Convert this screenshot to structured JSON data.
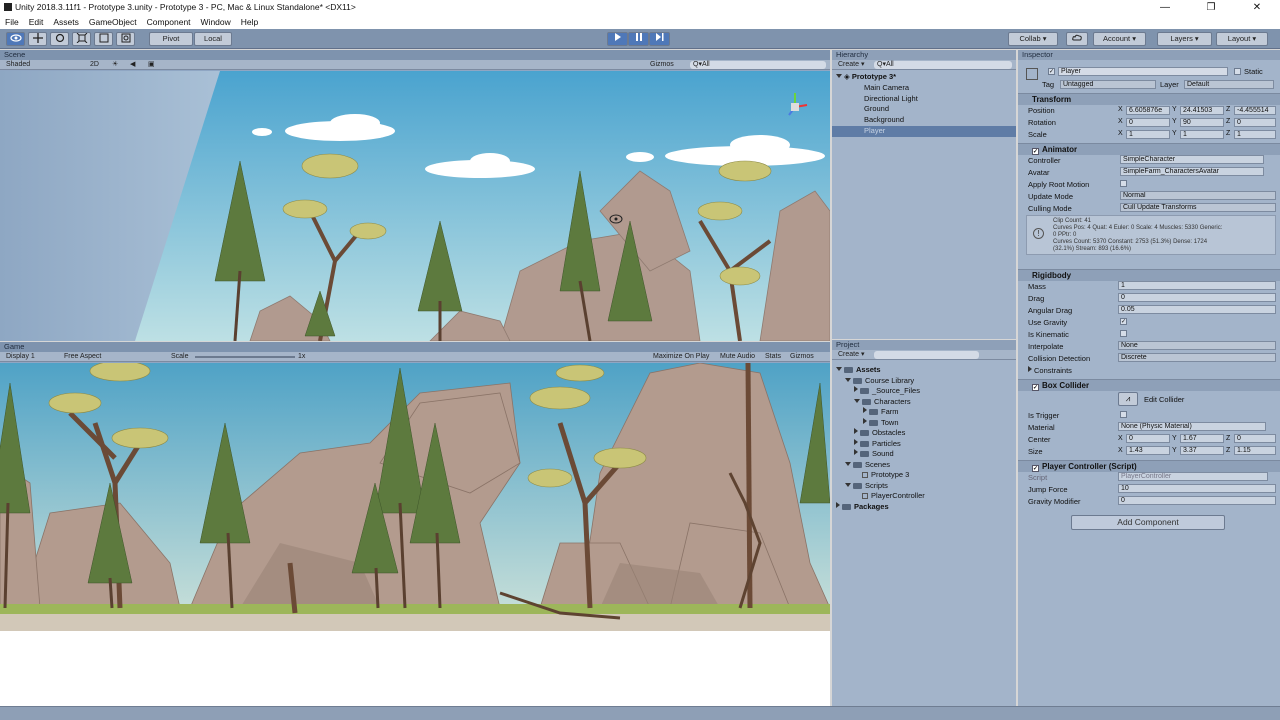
{
  "window": {
    "title": "Unity 2018.3.11f1 - Prototype 3.unity - Prototype 3 - PC, Mac & Linux Standalone* <DX11>",
    "controls": [
      "—",
      "❐",
      "✕"
    ]
  },
  "menu": [
    "File",
    "Edit",
    "Assets",
    "GameObject",
    "Component",
    "Window",
    "Help"
  ],
  "toolbar": {
    "tools": [
      "hand-tool-icon",
      "move-tool-icon",
      "rotate-tool-icon",
      "scale-tool-icon",
      "rect-tool-icon",
      "transform-tool-icon"
    ],
    "pivot": "Pivot",
    "local": "Local",
    "collab": "Collab ▾",
    "account": "Account",
    "layers": "Layers",
    "layout": "Layout",
    "accent": "#4f78b8"
  },
  "scene": {
    "tab": "Scene",
    "shading": "Shaded",
    "mode2d": "2D",
    "gizmos": "Gizmos",
    "search": "Q▾All"
  },
  "game": {
    "tab": "Game",
    "display": "Display 1",
    "aspect": "Free Aspect",
    "scale_label": "Scale",
    "scale_value": "1x",
    "maximize": "Maximize On Play",
    "mute": "Mute Audio",
    "stats": "Stats",
    "gizmos": "Gizmos"
  },
  "hierarchy": {
    "tab": "Hierarchy",
    "create": "Create ▾",
    "search": "Q▾All",
    "root": "Prototype 3*",
    "items": [
      "Main Camera",
      "Directional Light",
      "Ground",
      "Background",
      "Player"
    ]
  },
  "project": {
    "tab": "Project",
    "create": "Create ▾",
    "tree": [
      {
        "label": "Assets",
        "depth": 0,
        "bold": true
      },
      {
        "label": "Course Library",
        "depth": 1
      },
      {
        "label": "_Source_Files",
        "depth": 2
      },
      {
        "label": "Characters",
        "depth": 2
      },
      {
        "label": "Farm",
        "depth": 3
      },
      {
        "label": "Town",
        "depth": 3
      },
      {
        "label": "Obstacles",
        "depth": 2
      },
      {
        "label": "Particles",
        "depth": 2
      },
      {
        "label": "Sound",
        "depth": 2
      },
      {
        "label": "Scenes",
        "depth": 1
      },
      {
        "label": "Prototype 3",
        "depth": 2
      },
      {
        "label": "Scripts",
        "depth": 1
      },
      {
        "label": "PlayerController",
        "depth": 2
      },
      {
        "label": "Packages",
        "depth": 0,
        "bold": true
      }
    ]
  },
  "inspector": {
    "tab": "Inspector",
    "object_name": "Player",
    "static": "Static",
    "tag_label": "Tag",
    "tag": "Untagged",
    "layer_label": "Layer",
    "layer": "Default",
    "transform": {
      "title": "Transform",
      "position_label": "Position",
      "position": [
        "6.605876e",
        "24.41503",
        "-4.455514"
      ],
      "rotation_label": "Rotation",
      "rotation": [
        "0",
        "90",
        "0"
      ],
      "scale_label": "Scale",
      "scale": [
        "1",
        "1",
        "1"
      ]
    },
    "animator": {
      "title": "Animator",
      "controller_label": "Controller",
      "controller": "SimpleCharacter",
      "avatar_label": "Avatar",
      "avatar": "SimpleFarm_CharactersAvatar",
      "root_motion_label": "Apply Root Motion",
      "update_mode_label": "Update Mode",
      "update_mode": "Normal",
      "culling_label": "Culling Mode",
      "culling": "Cull Update Transforms",
      "info": [
        "Clip Count: 41",
        "Curves Pos: 4 Quat: 4 Euler: 0 Scale: 4 Muscles: 5330 Generic:",
        "0 PPtr: 0",
        "Curves Count: 5370 Constant: 2753 (51.3%) Dense: 1724",
        "(32.1%) Stream: 893 (16.6%)"
      ]
    },
    "rigidbody": {
      "title": "Rigidbody",
      "mass_label": "Mass",
      "mass": "1",
      "drag_label": "Drag",
      "drag": "0",
      "angular_label": "Angular Drag",
      "angular": "0.05",
      "gravity_label": "Use Gravity",
      "kinematic_label": "Is Kinematic",
      "interp_label": "Interpolate",
      "interp": "None",
      "collision_label": "Collision Detection",
      "collision": "Discrete",
      "constraints_label": "Constraints"
    },
    "box_collider": {
      "title": "Box Collider",
      "edit": "Edit Collider",
      "trigger_label": "Is Trigger",
      "material_label": "Material",
      "material": "None (Physic Material)",
      "center_label": "Center",
      "center": [
        "0",
        "1.67",
        "0"
      ],
      "size_label": "Size",
      "size": [
        "1.43",
        "3.37",
        "1.15"
      ]
    },
    "player_controller": {
      "title": "Player Controller (Script)",
      "script_label": "Script",
      "script": "PlayerController",
      "jump_label": "Jump Force",
      "jump": "10",
      "gravity_mod_label": "Gravity Modifier",
      "gravity_mod": "0"
    },
    "add_component": "Add Component"
  }
}
